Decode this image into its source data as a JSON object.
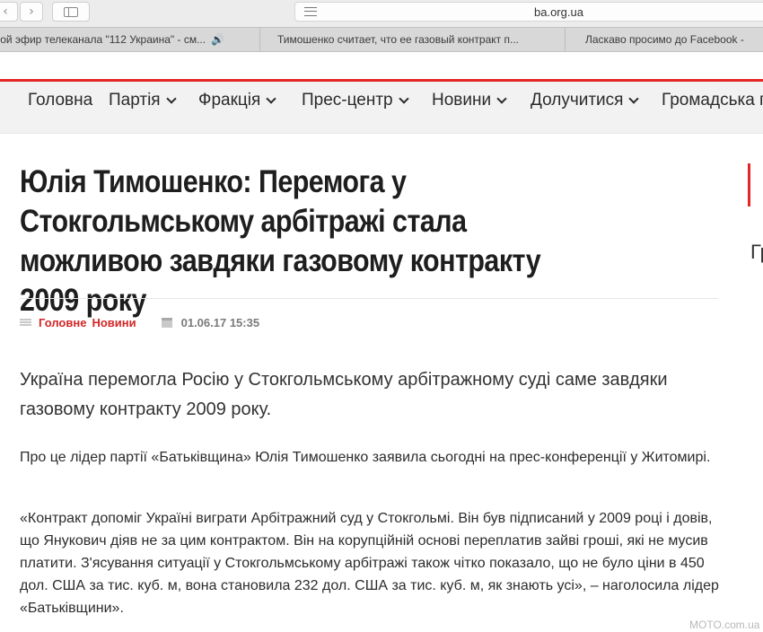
{
  "browser": {
    "url": "ba.org.ua",
    "tabs": [
      {
        "label": "мой эфир телеканала \"112 Украина\" - см...",
        "audio": true
      },
      {
        "label": "Тимошенко считает, что ее газовый контракт п..."
      },
      {
        "label": "Ласкаво просимо до Facebook -"
      }
    ]
  },
  "nav": {
    "items": [
      {
        "label": "Головна",
        "dropdown": false
      },
      {
        "label": "Партія",
        "dropdown": true
      },
      {
        "label": "Фракція",
        "dropdown": true
      },
      {
        "label": "Прес-центр",
        "dropdown": true
      },
      {
        "label": "Новини",
        "dropdown": true
      },
      {
        "label": "Долучитися",
        "dropdown": true
      },
      {
        "label": "Громадська п",
        "dropdown": false
      }
    ]
  },
  "article": {
    "title": "Юлія Тимошенко: Перемога у Стокгольмському арбітражі стала можливою завдяки газовому контракту 2009 року",
    "categories": [
      "Головне",
      "Новини"
    ],
    "date": "01.06.17 15:35",
    "lead": "Україна перемогла Росію у Стокгольмському арбітражному суді саме завдяки газовому контракту 2009 року.",
    "paragraphs": [
      "Про це лідер партії «Батьківщина» Юлія Тимошенко заявила сьогодні на прес-конференції у Житомирі.",
      "«Контракт допоміг  Україні виграти Арбітражний суд у Стокгольмі. Він був підписаний у 2009 році і довів, що Янукович діяв не за цим контрактом. Він на корупційній основі переплатив зайві гроші, які не мусив платити. З'ясування ситуації у Стокгольмському арбітражі також чітко показало, що не було ціни в 450 дол. США за тис. куб. м,  вона становила 232 дол. США за тис. куб. м, як знають усі», – наголосила лідер «Батьківщини»."
    ]
  },
  "sidebar": {
    "partial_text": "Гр"
  },
  "watermark": "MOTO.com.ua",
  "colors": {
    "accent": "#e32626",
    "nav_bg": "#f2f2f2",
    "toolbar_bg": "#ececec"
  }
}
